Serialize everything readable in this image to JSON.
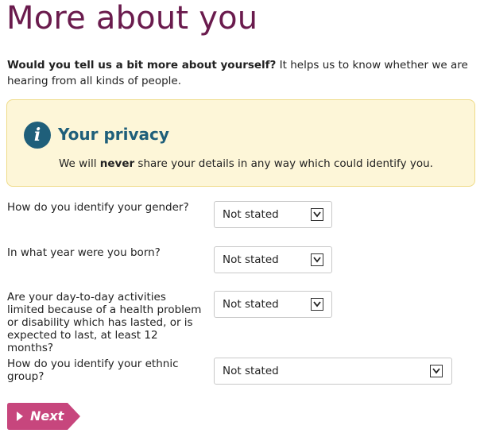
{
  "page": {
    "title": "More about you",
    "intro_bold": "Would you tell us a bit more about yourself?",
    "intro_rest": " It helps us to know whether we are hearing from all kinds of people."
  },
  "privacy": {
    "icon": "info-icon",
    "icon_glyph": "i",
    "title": "Your privacy",
    "text_before": "We will ",
    "text_bold": "never",
    "text_after": " share your details in any way which could identify you."
  },
  "questions": [
    {
      "label": "How do you identify your gender?",
      "value": "Not stated"
    },
    {
      "label": "In what year were you born?",
      "value": "Not stated"
    },
    {
      "label": "Are your day-to-day activities limited because of a health problem or disability which has lasted, or is expected to last, at least 12 months?",
      "value": "Not stated"
    },
    {
      "label": "How do you identify your ethnic group?",
      "value": "Not stated"
    }
  ],
  "next_button": {
    "label": "Next",
    "icon": "chevron-right-icon"
  },
  "colors": {
    "title": "#6a1b4d",
    "privacy_bg": "#fdf6d8",
    "privacy_border": "#efdb88",
    "privacy_accent": "#1f5f7a",
    "next_button": "#c7467d"
  }
}
